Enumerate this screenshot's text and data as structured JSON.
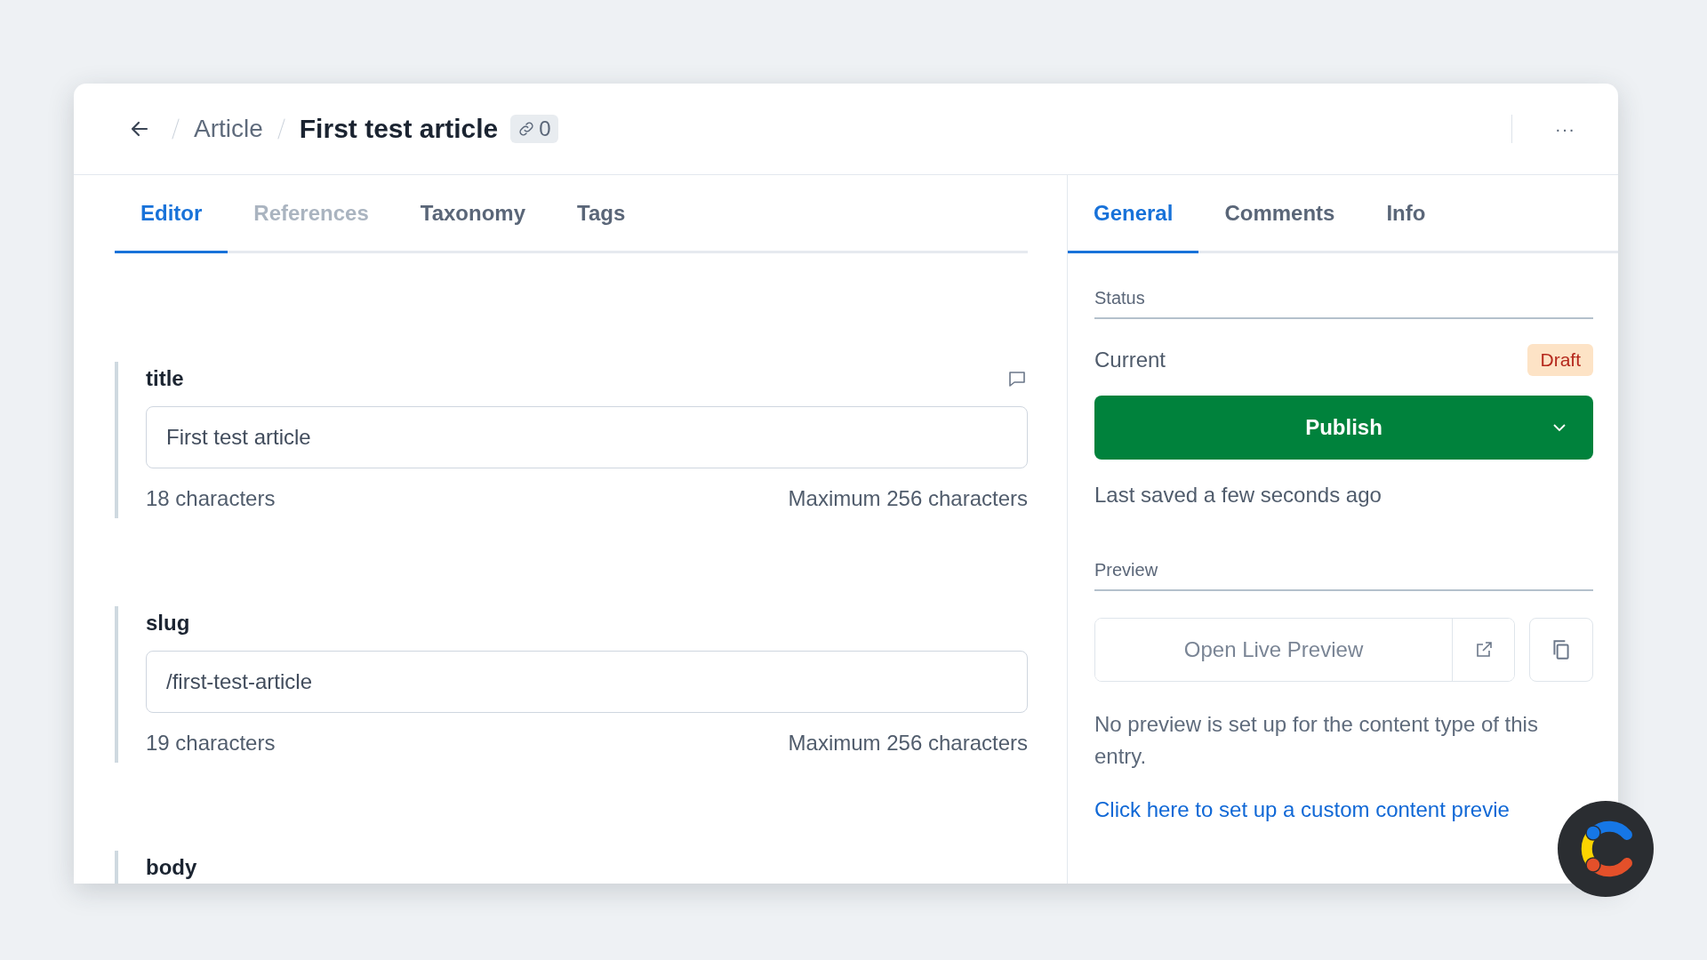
{
  "header": {
    "breadcrumb": [
      "Article"
    ],
    "title": "First test article",
    "references_count": "0",
    "more_button": "···"
  },
  "left_tabs": [
    {
      "label": "Editor",
      "selected": true,
      "disabled": false
    },
    {
      "label": "References",
      "selected": false,
      "disabled": true
    },
    {
      "label": "Taxonomy",
      "selected": false,
      "disabled": false
    },
    {
      "label": "Tags",
      "selected": false,
      "disabled": false
    }
  ],
  "fields": [
    {
      "label": "title",
      "comment_icon": true,
      "value": "First test article",
      "count": "18 characters",
      "limit": "Maximum 256 characters"
    },
    {
      "label": "slug",
      "comment_icon": false,
      "value": "/first-test-article",
      "count": "19 characters",
      "limit": "Maximum 256 characters"
    },
    {
      "label": "body",
      "comment_icon": false
    }
  ],
  "right_tabs": [
    {
      "label": "General",
      "selected": true
    },
    {
      "label": "Comments",
      "selected": false
    },
    {
      "label": "Info",
      "selected": false
    }
  ],
  "status": {
    "heading": "Status",
    "current_label": "Current",
    "badge": "Draft",
    "publish_button": "Publish",
    "last_saved": "Last saved a few seconds ago"
  },
  "preview": {
    "heading": "Preview",
    "open_button": "Open Live Preview",
    "note": "No preview is set up for the content type of this entry.",
    "link": "Click here to set up a custom content previe"
  }
}
